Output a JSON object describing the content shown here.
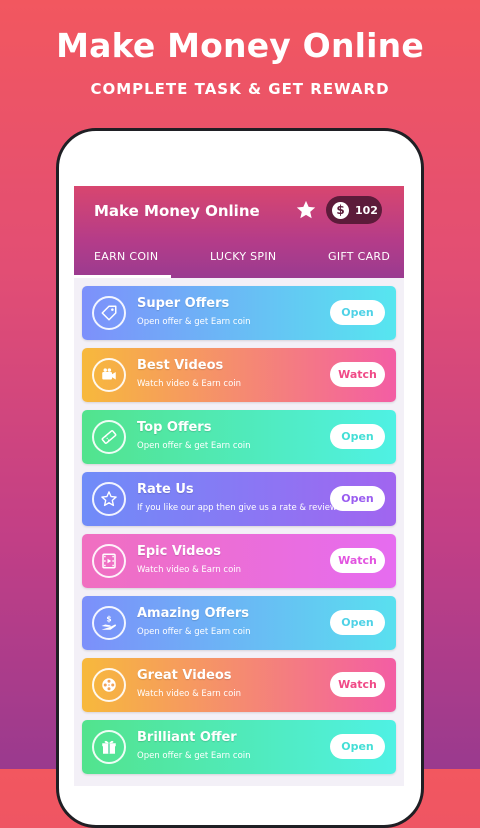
{
  "promo": {
    "title": "Make Money Online",
    "subtitle": "COMPLETE TASK & GET REWARD"
  },
  "app": {
    "title": "Make Money Online",
    "coins": "102",
    "coin_symbol": "$",
    "tabs": [
      "EARN COIN",
      "LUCKY SPIN",
      "GIFT CARD"
    ]
  },
  "cards": [
    {
      "title": "Super Offers",
      "desc": "Open offer & get Earn coin",
      "button": "Open",
      "icon": "tag-icon",
      "from": "#7d90fb",
      "to": "#56e6ef",
      "btn_color": "#4fd2e6"
    },
    {
      "title": "Best Videos",
      "desc": "Watch video & Earn coin",
      "button": "Watch",
      "icon": "video-camera-icon",
      "from": "#f7b93c",
      "to": "#f35da4",
      "btn_color": "#f04a87"
    },
    {
      "title": "Top Offers",
      "desc": "Open offer & get Earn coin",
      "button": "Open",
      "icon": "ticket-icon",
      "from": "#52e38d",
      "to": "#4ff1e4",
      "btn_color": "#44dfd6"
    },
    {
      "title": "Rate Us",
      "desc": "If you like our app then give us a rate & review",
      "button": "Open",
      "icon": "star-outline-icon",
      "from": "#6f8cf8",
      "to": "#a165f0",
      "btn_color": "#9a5df0"
    },
    {
      "title": "Epic Videos",
      "desc": "Watch video & Earn coin",
      "button": "Watch",
      "icon": "film-icon",
      "from": "#f06fc0",
      "to": "#e66cf0",
      "btn_color": "#e254e0"
    },
    {
      "title": "Amazing Offers",
      "desc": "Open offer & get Earn coin",
      "button": "Open",
      "icon": "hand-coin-icon",
      "from": "#7c8ffa",
      "to": "#59e0ef",
      "btn_color": "#4fd2e6"
    },
    {
      "title": "Great Videos",
      "desc": "Watch video & Earn coin",
      "button": "Watch",
      "icon": "reel-icon",
      "from": "#f7b93c",
      "to": "#f35da4",
      "btn_color": "#f04a87"
    },
    {
      "title": "Brilliant Offer",
      "desc": "Open offer & get Earn coin",
      "button": "Open",
      "icon": "gift-icon",
      "from": "#52e38d",
      "to": "#4ff1e4",
      "btn_color": "#44dfd6"
    }
  ]
}
